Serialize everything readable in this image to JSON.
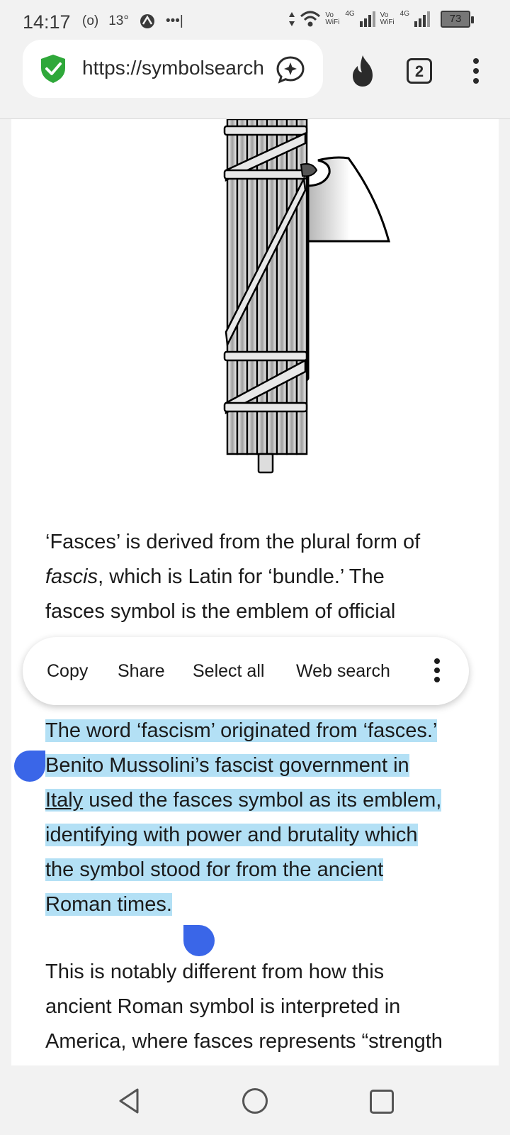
{
  "status_bar": {
    "time": "14:17",
    "temperature": "13°",
    "left_icons": [
      "hotspot-icon",
      "app-notification-icon",
      "more-dots-icon"
    ],
    "network_label_1": "Vo WiFi",
    "network_label_2": "4G",
    "network_label_3": "Vo WiFi",
    "network_label_4": "4G",
    "battery": "73"
  },
  "browser": {
    "url": "https://symbolsearch",
    "tab_count": "2",
    "icons": [
      "security-shield-icon",
      "ai-assistant-icon",
      "flame-icon",
      "overflow-menu-icon"
    ],
    "accent_color": "#2fa83a"
  },
  "article": {
    "para1_part1": "‘Fasces’ is derived from the plural form of",
    "para1_italic": "fascis",
    "para1_part2": ", which is Latin for ‘bundle.’ The",
    "para1_line3": "fasces symbol is the emblem of official",
    "para2_line1": "The word ‘fascism’ originated from ‘fasces.’",
    "para2_line2": "Benito Mussolini’s fascist government in",
    "para2_link": "Italy",
    "para2_line3_rest": " used the fasces symbol as its emblem,",
    "para2_line4": "identifying with power and brutality which",
    "para2_line5": "the symbol stood for from the ancient",
    "para2_line6": "Roman times.",
    "para3_line1": "This is notably different from how this",
    "para3_line2": "ancient Roman symbol is interpreted in",
    "para3_line3": "America, where fasces represents “strength"
  },
  "context_menu": {
    "copy": "Copy",
    "share": "Share",
    "select_all": "Select all",
    "web_search": "Web search",
    "more_icon": "more-vertical-icon"
  },
  "selection": {
    "highlight_color": "#b3e0f5",
    "handle_color": "#3a66e8"
  },
  "nav_bar": {
    "icons": [
      "back-icon",
      "home-icon",
      "recents-icon"
    ]
  }
}
